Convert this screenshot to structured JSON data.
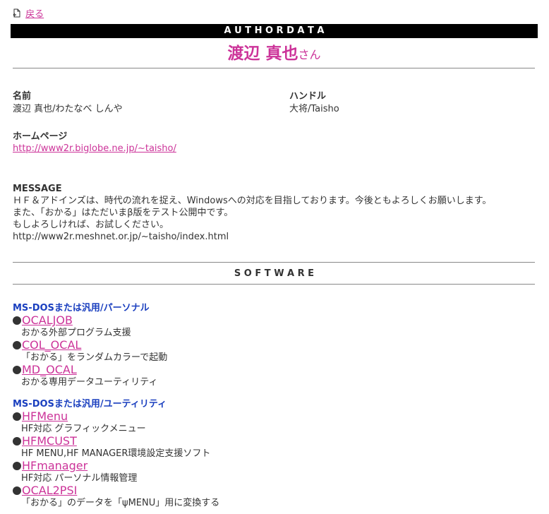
{
  "back": {
    "label": "戻る"
  },
  "banner": {
    "title": "A U T H O R D A T A"
  },
  "author": {
    "name": "渡辺 真也",
    "suffix": "さん"
  },
  "fields": {
    "name_label": "名前",
    "name_value": "渡辺 真也/わたなべ しんや",
    "handle_label": "ハンドル",
    "handle_value": "大将/Taisho",
    "homepage_label": "ホームページ",
    "homepage_url": "http://www2r.biglobe.ne.jp/~taisho/"
  },
  "message": {
    "label": "MESSAGE",
    "lines": [
      "ＨＦ＆アドインズは、時代の流れを捉え、Windowsへの対応を目指しております。今後ともよろしくお願いします。",
      "また、「おかる」はただいまβ版をテスト公開中です。",
      "もしよろしければ、お試しください。",
      "http://www2r.meshnet.or.jp/~taisho/index.html"
    ]
  },
  "software": {
    "title": "S O F T W A R E",
    "categories": [
      {
        "name": "MS-DOSまたは汎用/パーソナル",
        "items": [
          {
            "name": "OCALJOB",
            "desc": "おかる外部プログラム支援"
          },
          {
            "name": "COL_OCAL",
            "desc": "「おかる」をランダムカラーで起動"
          },
          {
            "name": "MD_OCAL",
            "desc": "おかる専用データユーティリティ"
          }
        ]
      },
      {
        "name": "MS-DOSまたは汎用/ユーティリティ",
        "items": [
          {
            "name": "HFMenu",
            "desc": "HF対応 グラフィックメニュー"
          },
          {
            "name": "HFMCUST",
            "desc": "HF MENU,HF MANAGER環境設定支援ソフト"
          },
          {
            "name": "HFmanager",
            "desc": "HF対応 パーソナル情報管理"
          },
          {
            "name": "OCAL2PSI",
            "desc": "「おかる」のデータを「ψMENU」用に変換する"
          }
        ]
      }
    ]
  },
  "colors": {
    "link": "#cc3399",
    "category": "#1a3fbf",
    "banner_bg": "#000000"
  }
}
